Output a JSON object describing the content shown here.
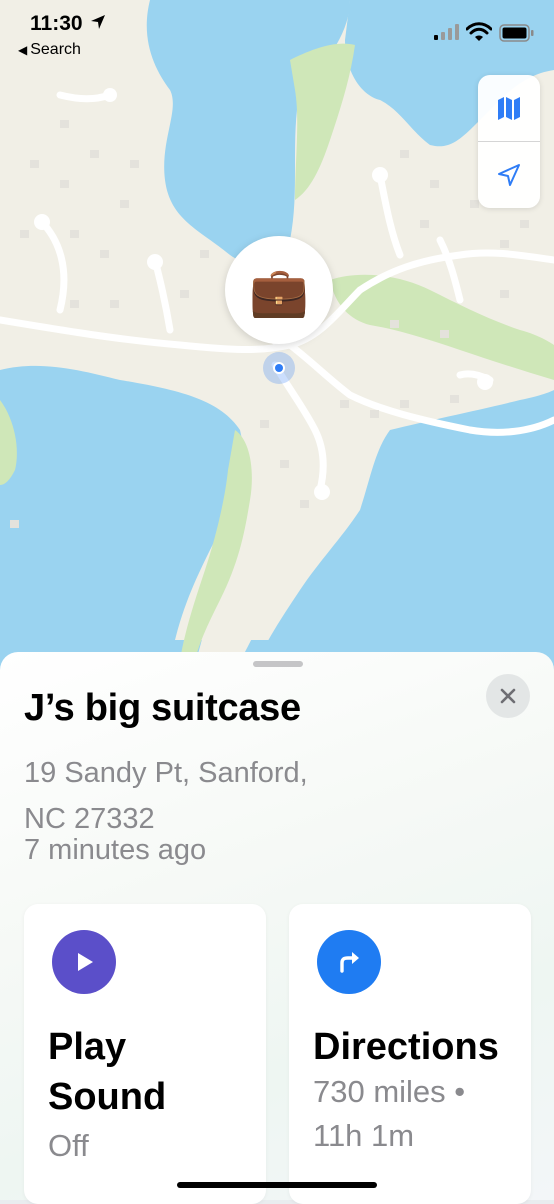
{
  "status_bar": {
    "time": "11:30",
    "back_label": "Search"
  },
  "item": {
    "emoji": "💼",
    "name": "J’s big suitcase",
    "address_line1": "19 Sandy Pt, Sanford,",
    "address_line2": "NC  27332",
    "last_seen": "7 minutes ago"
  },
  "actions": {
    "play_sound": {
      "label_line1": "Play",
      "label_line2": "Sound",
      "status": "Off",
      "icon": "play-icon",
      "color": "#5b4fc9"
    },
    "directions": {
      "label": "Directions",
      "distance": "730 miles •",
      "duration": "11h 1m",
      "icon": "turn-right-arrow-icon",
      "color": "#1f7cf2"
    }
  },
  "colors": {
    "water": "#9ad3f0",
    "land": "#f1efe6",
    "park": "#cfe7b8",
    "accent": "#2f7df6"
  }
}
